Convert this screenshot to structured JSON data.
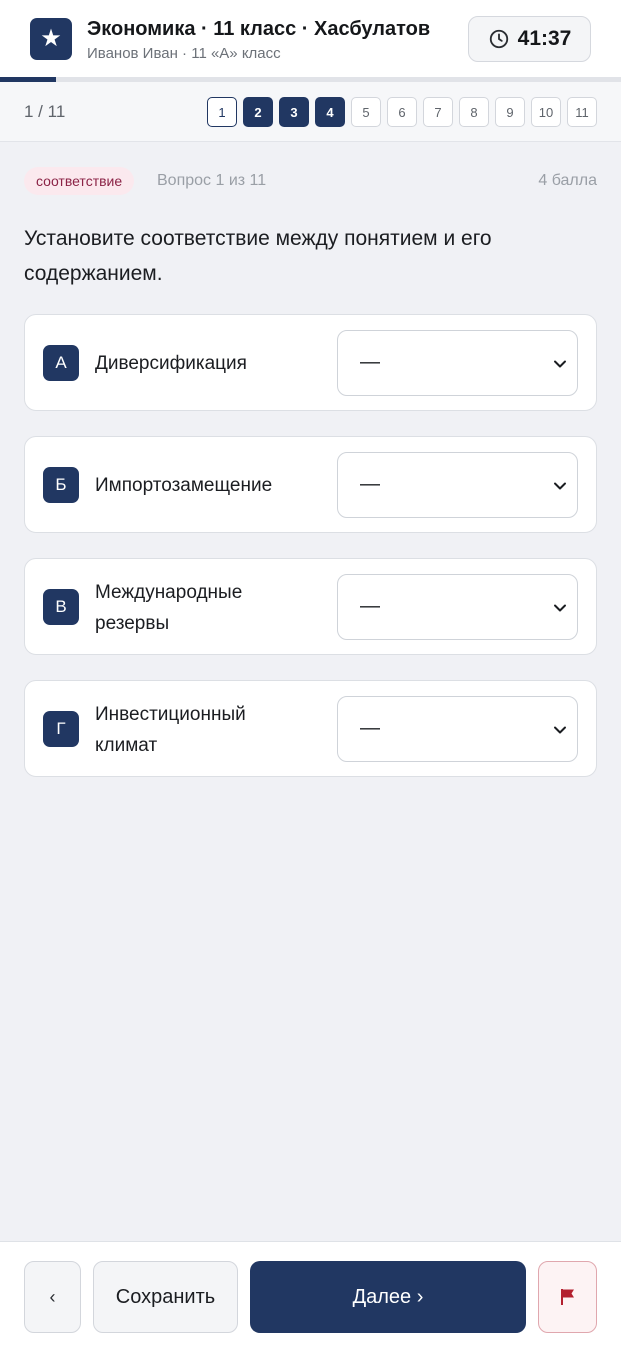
{
  "header": {
    "logo_glyph": "★",
    "title": "Экономика · 11 класс · Хасбулатов",
    "subtitle": "Иванов Иван · 11 «А» класс",
    "timer": "41:37",
    "timer_icon": "clock-icon"
  },
  "progress": {
    "fraction": 0.09
  },
  "navigator": {
    "counter": "1 / 11",
    "questions": [
      {
        "label": "1",
        "state": "current"
      },
      {
        "label": "2",
        "state": "answered"
      },
      {
        "label": "3",
        "state": "answered"
      },
      {
        "label": "4",
        "state": "answered"
      },
      {
        "label": "5",
        "state": "empty"
      },
      {
        "label": "6",
        "state": "empty"
      },
      {
        "label": "7",
        "state": "empty"
      },
      {
        "label": "8",
        "state": "empty"
      },
      {
        "label": "9",
        "state": "empty"
      },
      {
        "label": "10",
        "state": "empty"
      },
      {
        "label": "11",
        "state": "empty"
      }
    ]
  },
  "question": {
    "type_tag": "соответствие",
    "number": "Вопрос 1 из 11",
    "points": "4 балла",
    "text": "Установите соответствие между понятием и его содержанием.",
    "rows": [
      {
        "letter": "А",
        "term": "Диверсификация",
        "selected": "—"
      },
      {
        "letter": "Б",
        "term": "Импортозамещение",
        "selected": "—"
      },
      {
        "letter": "В",
        "term": "Международные резервы",
        "selected": "—"
      },
      {
        "letter": "Г",
        "term": "Инвестиционный климат",
        "selected": "—"
      }
    ]
  },
  "footer": {
    "prev": "‹",
    "save": "Сохранить",
    "next": "Далее ›",
    "flag_icon": "flag-icon"
  },
  "colors": {
    "primary": "#213762",
    "tag_bg": "#fbe9ee",
    "tag_text": "#8b2346",
    "flag": "#b3202f"
  }
}
